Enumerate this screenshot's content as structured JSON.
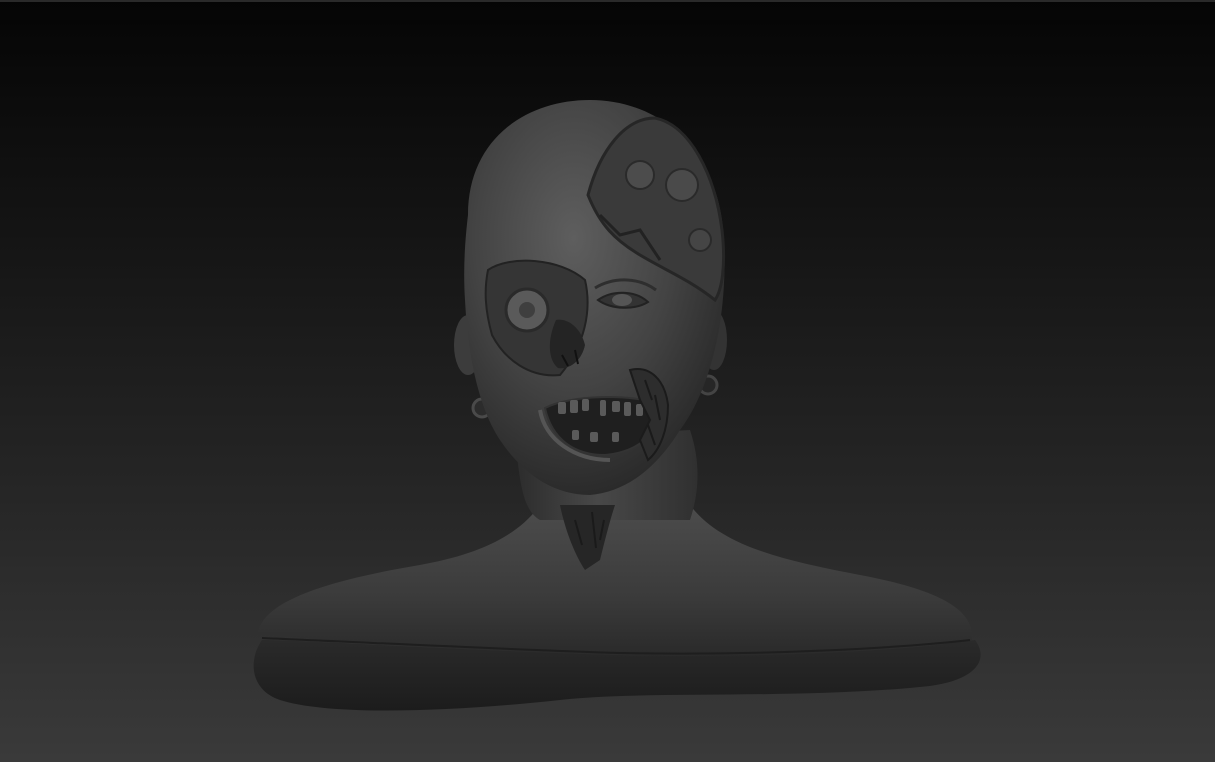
{
  "viewport": {
    "background_top": "#050505",
    "background_bottom": "#3a3a3a"
  },
  "subject": {
    "kind": "sculpted zombie head bust",
    "material_color": "#4a4a4a",
    "shadow_color": "#1a1a1a",
    "highlight_color": "#6c6c6c"
  }
}
